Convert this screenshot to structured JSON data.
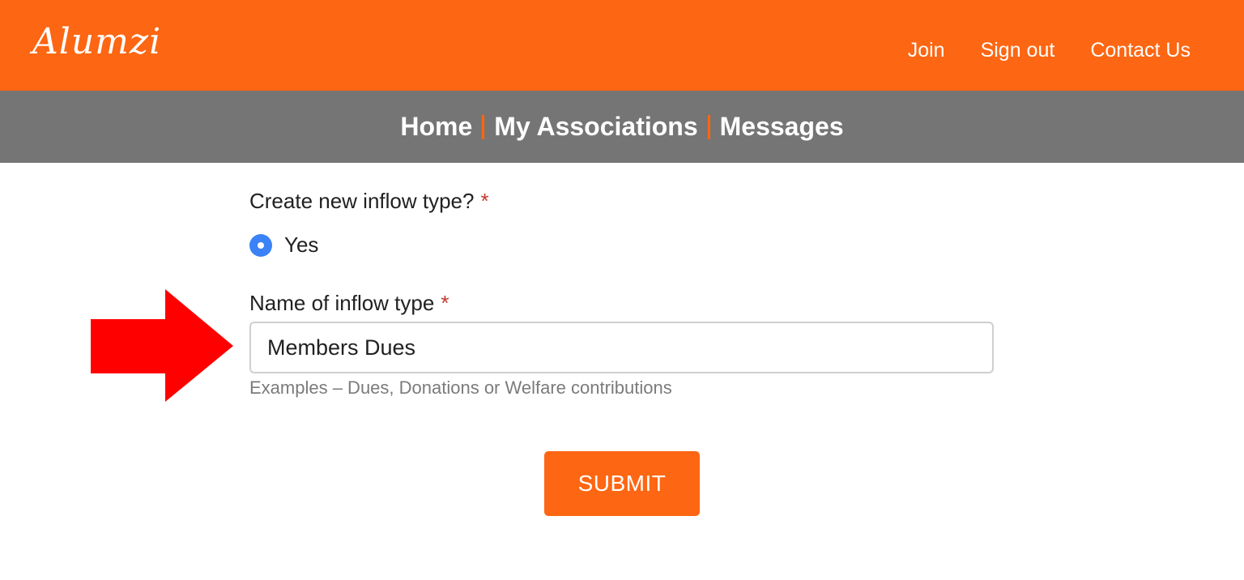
{
  "brand": {
    "logo": "Alumzi",
    "accent": "#fd6612",
    "subbar_color": "#757575"
  },
  "header": {
    "nav": [
      {
        "label": "Join"
      },
      {
        "label": "Sign out"
      },
      {
        "label": "Contact Us"
      }
    ]
  },
  "subnav": {
    "items": [
      {
        "label": "Home"
      },
      {
        "label": "My Associations"
      },
      {
        "label": "Messages"
      }
    ]
  },
  "form": {
    "create_question": "Create new inflow type?",
    "required_mark": "*",
    "radio_option": "Yes",
    "radio_selected": true,
    "name_label": "Name of inflow type",
    "name_value": "Members Dues",
    "helper": "Examples – Dues, Donations or Welfare contributions",
    "submit_label": "SUBMIT"
  },
  "annotation": {
    "arrow_color": "#ff0000",
    "icon": "right-arrow-icon"
  }
}
